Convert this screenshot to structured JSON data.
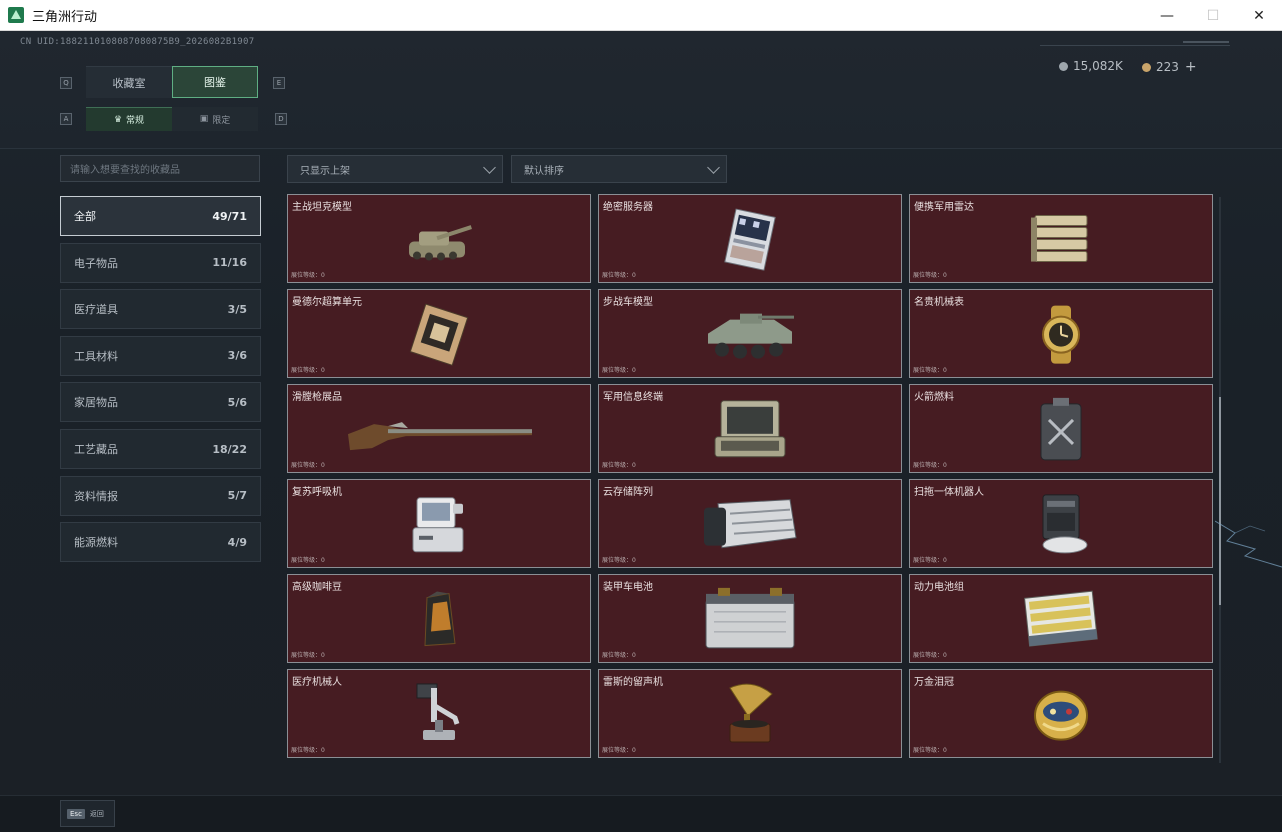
{
  "window": {
    "title": "三角洲行动",
    "controls": {
      "minimize": "—",
      "maximize": "☐",
      "close": "✕"
    }
  },
  "header": {
    "uid": "CN UID:1882110108087080875B9_2026082B1907",
    "currency_a": "15,082K",
    "currency_b": "223",
    "add_symbol": "+",
    "colors": {
      "accent": "#5fae83",
      "card_bg": "#461c22"
    }
  },
  "tabs": [
    {
      "label": "收藏室",
      "key": "Q",
      "active": false
    },
    {
      "label": "图鉴",
      "key": "E",
      "active": true
    }
  ],
  "subtabs": [
    {
      "label": "常规",
      "key": "A",
      "icon": "trophy-icon",
      "active": true
    },
    {
      "label": "限定",
      "key": "D",
      "icon": "image-icon",
      "active": false
    }
  ],
  "search": {
    "placeholder": "请输入想要查找的收藏品"
  },
  "filters": {
    "filter_label": "只显示上架",
    "sort_label": "默认排序"
  },
  "categories": [
    {
      "label": "全部",
      "count": "49/71",
      "active": true
    },
    {
      "label": "电子物品",
      "count": "11/16"
    },
    {
      "label": "医疗道具",
      "count": "3/5"
    },
    {
      "label": "工具材料",
      "count": "3/6"
    },
    {
      "label": "家居物品",
      "count": "5/6"
    },
    {
      "label": "工艺藏品",
      "count": "18/22"
    },
    {
      "label": "资料情报",
      "count": "5/7"
    },
    {
      "label": "能源燃料",
      "count": "4/9"
    }
  ],
  "items": [
    {
      "name": "主战坦克模型",
      "level": "展位等级：0",
      "icon": "tank-icon"
    },
    {
      "name": "绝密服务器",
      "level": "展位等级：0",
      "icon": "server-icon"
    },
    {
      "name": "便携军用雷达",
      "level": "展位等级：0",
      "icon": "radar-icon"
    },
    {
      "name": "曼德尔超算单元",
      "level": "展位等级：0",
      "icon": "chip-icon"
    },
    {
      "name": "步战车模型",
      "level": "展位等级：0",
      "icon": "ifv-icon"
    },
    {
      "name": "名贵机械表",
      "level": "展位等级：0",
      "icon": "watch-icon"
    },
    {
      "name": "滑膛枪展品",
      "level": "展位等级：0",
      "icon": "musket-icon"
    },
    {
      "name": "军用信息终端",
      "level": "展位等级：0",
      "icon": "terminal-icon"
    },
    {
      "name": "火箭燃料",
      "level": "展位等级：0",
      "icon": "fuel-icon"
    },
    {
      "name": "复苏呼吸机",
      "level": "展位等级：0",
      "icon": "ventilator-icon"
    },
    {
      "name": "云存储阵列",
      "level": "展位等级：0",
      "icon": "storage-icon"
    },
    {
      "name": "扫拖一体机器人",
      "level": "展位等级：0",
      "icon": "robot-vacuum-icon"
    },
    {
      "name": "高级咖啡豆",
      "level": "展位等级：0",
      "icon": "coffee-icon"
    },
    {
      "name": "装甲车电池",
      "level": "展位等级：0",
      "icon": "battery-icon"
    },
    {
      "name": "动力电池组",
      "level": "展位等级：0",
      "icon": "battery-pack-icon"
    },
    {
      "name": "医疗机械人",
      "level": "展位等级：0",
      "icon": "medical-robot-icon"
    },
    {
      "name": "雷斯的留声机",
      "level": "展位等级：0",
      "icon": "gramophone-icon"
    },
    {
      "name": "万金泪冠",
      "level": "展位等级：0",
      "icon": "crown-icon"
    }
  ],
  "footer": {
    "esc_key": "Esc",
    "back_label": "返回"
  }
}
